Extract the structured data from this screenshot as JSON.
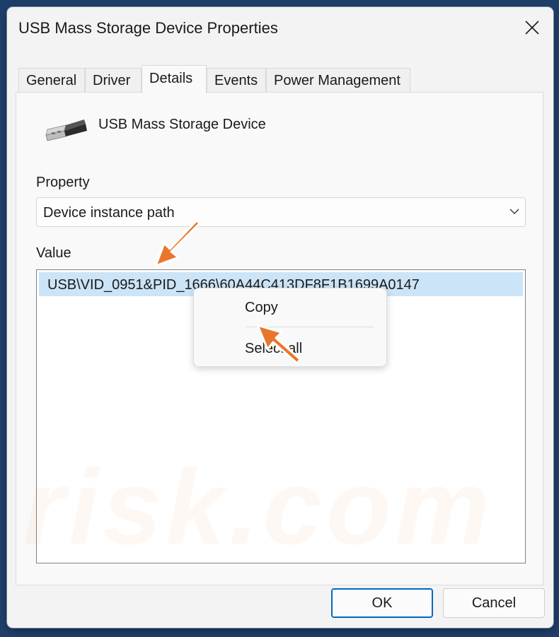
{
  "window": {
    "title": "USB Mass Storage Device Properties"
  },
  "tabs": [
    {
      "label": "General"
    },
    {
      "label": "Driver"
    },
    {
      "label": "Details"
    },
    {
      "label": "Events"
    },
    {
      "label": "Power Management"
    }
  ],
  "active_tab": "Details",
  "device": {
    "name": "USB Mass Storage Device",
    "icon": "usb-connector-icon"
  },
  "property": {
    "label": "Property",
    "selected": "Device instance path"
  },
  "value": {
    "label": "Value",
    "rows": [
      "USB\\VID_0951&PID_1666\\60A44C413DF8F1B1699A0147"
    ]
  },
  "context_menu": {
    "items": [
      {
        "label": "Copy"
      },
      {
        "label": "Select all"
      }
    ]
  },
  "buttons": {
    "ok": "OK",
    "cancel": "Cancel"
  },
  "watermark": "risk.com",
  "colors": {
    "selection": "#cce4f7",
    "accent": "#0067c0",
    "annotation_arrow": "#e8772e"
  }
}
